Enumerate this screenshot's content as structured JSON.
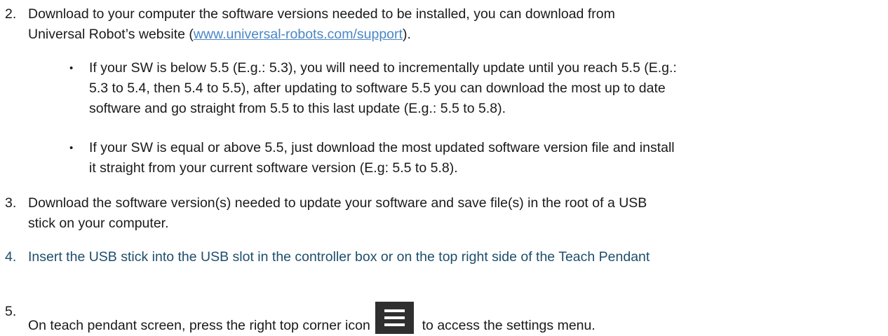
{
  "steps": [
    {
      "number": "2.",
      "text_before": "Download to your computer the software versions needed to be installed, you can download from",
      "text_line2_pre": "Universal Robot’s website (",
      "link": "www.universal-robots.com/support",
      "text_line2_post": ")."
    },
    {
      "number": "3.",
      "line1": "Download the software version(s) needed to update your software and save file(s) in the root of a USB",
      "line2": "stick on your computer."
    },
    {
      "number": "4.",
      "line1": "Insert the USB stick into the USB slot in the controller box or on the top right side of the Teach Pendant"
    },
    {
      "number": "5.",
      "text_before_icon": "On teach pendant screen, press the right top corner icon",
      "icon": "hamburger-menu-icon",
      "text_after_icon": "to access the settings menu."
    }
  ],
  "bullets": [
    {
      "symbol": "•",
      "lines": [
        "If your SW is below 5.5 (E.g.: 5.3), you will need to incrementally update until you reach 5.5 (E.g.:",
        "5.3 to 5.4, then 5.4 to 5.5), after updating to software 5.5 you can download the most up to date",
        "software and go straight from 5.5 to this last update (E.g.: 5.5 to 5.8)."
      ]
    },
    {
      "symbol": "•",
      "lines": [
        "If your SW is equal or above 5.5, just download the most updated software version file and install",
        "it straight from your current software version (E.g: 5.5 to 5.8)."
      ]
    }
  ],
  "colors": {
    "text": "#1a1a1a",
    "link": "#4a86c5",
    "step4_text": "#1d4e6b",
    "icon_bg": "#2f2f2f"
  }
}
